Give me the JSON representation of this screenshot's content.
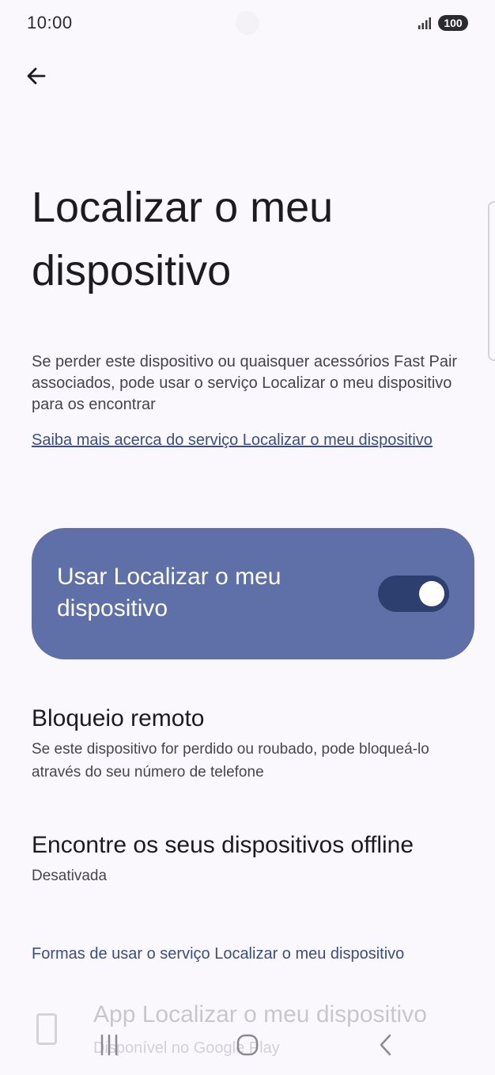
{
  "status_bar": {
    "time": "10:00",
    "battery": "100",
    "icons": [
      "signal-icon",
      "battery-icon"
    ]
  },
  "header": {
    "back_icon": "arrow-left-icon",
    "title": "Localizar o meu dispositivo"
  },
  "intro": {
    "description": "Se perder este dispositivo ou quaisquer acessórios Fast Pair associados, pode usar o serviço Localizar o meu dispositivo para os encontrar",
    "learn_more_link": "Saiba mais acerca do serviço Localizar o meu dispositivo"
  },
  "main_switch": {
    "label": "Usar Localizar o meu dispositivo",
    "enabled": true,
    "colors": {
      "card": "#5f70a8",
      "track": "#2c3f6e",
      "knob": "#ffffff"
    }
  },
  "settings": [
    {
      "title": "Bloqueio remoto",
      "subtitle": "Se este dispositivo for perdido ou roubado, pode bloqueá-lo através do seu número de telefone"
    },
    {
      "title": "Encontre os seus dispositivos offline",
      "subtitle": "Desativada"
    }
  ],
  "ways_section": {
    "header": "Formas de usar o serviço Localizar o meu dispositivo",
    "items": [
      {
        "icon": "smartphone-icon",
        "title": "App Localizar o meu dispositivo",
        "subtitle": "Disponível no Google Play"
      }
    ]
  },
  "nav_bar": {
    "icons": [
      "recent-apps-icon",
      "home-icon",
      "back-icon"
    ]
  },
  "colors": {
    "background": "#fbf8fd",
    "accent": "#3a4e86",
    "text_primary": "#1b1b20",
    "text_secondary": "#46464c"
  }
}
